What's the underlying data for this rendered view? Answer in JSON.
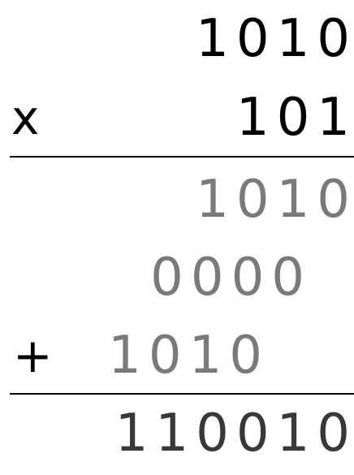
{
  "multiplication": {
    "multiplicand": "1010",
    "operator_times": "x",
    "multiplier": "101",
    "partial_products": [
      "1010",
      "0000",
      "1010"
    ],
    "operator_plus": "+",
    "result": "110010"
  },
  "colors": {
    "operands": "#000000",
    "partials": "#7a7a7a",
    "result": "#383838",
    "rules": "#000000"
  }
}
